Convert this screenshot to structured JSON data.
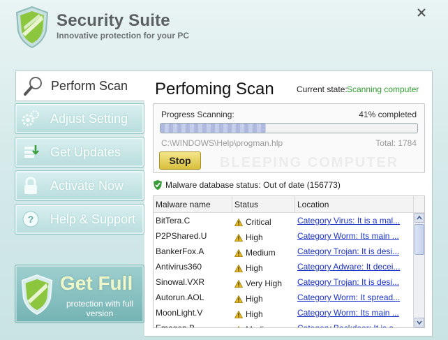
{
  "app": {
    "title": "Security Suite",
    "subtitle": "Innovative protection for your PC"
  },
  "nav": {
    "active": {
      "label": "Perform Scan",
      "icon": "magnifier-icon"
    },
    "items": [
      {
        "label": "Adjust Setting",
        "icon": "gears-icon"
      },
      {
        "label": "Get Updates",
        "icon": "updates-icon"
      },
      {
        "label": "Activate Now",
        "icon": "padlock-icon"
      },
      {
        "label": "Help & Support",
        "icon": "question-icon"
      }
    ]
  },
  "promo": {
    "title": "Get Full",
    "subtitle": "protection with full version"
  },
  "scan": {
    "title": "Perfoming Scan",
    "state_label": "Current state:",
    "state_value": "Scanning computer",
    "progress_label": "Progress Scanning:",
    "percent_text": "41% completed",
    "progress_fraction": 0.41,
    "current_file": "C:\\WINDOWS\\Help\\progman.hlp",
    "total_text": "Total: 1784",
    "stop_label": "Stop",
    "watermark": "BLEEPING COMPUTER"
  },
  "db_status": "Malware database status: Out of date (156773)",
  "table": {
    "columns": [
      "Malware name",
      "Status",
      "Location"
    ],
    "rows": [
      {
        "name": "BitTera.C",
        "status": "Critical",
        "location": "Category Virus: It is a mal..."
      },
      {
        "name": "P2PShared.U",
        "status": "High",
        "location": "Category Worm: Its main ..."
      },
      {
        "name": "BankerFox.A",
        "status": "Medium",
        "location": "Category Trojan: It is desi..."
      },
      {
        "name": "Antivirus360",
        "status": "High",
        "location": "Category Adware: It decei..."
      },
      {
        "name": "Sinowal.VXR",
        "status": "Very High",
        "location": "Category Trojan: It is desi..."
      },
      {
        "name": "Autorun.AOL",
        "status": "High",
        "location": "Category Worm: It spread..."
      },
      {
        "name": "MoonLight.V",
        "status": "High",
        "location": "Category Worm: Its main ..."
      },
      {
        "name": "Emogen.B",
        "status": "Medium",
        "location": "Category Backdoor: It is a ..."
      }
    ]
  },
  "colors": {
    "accent": "#2e9e2e",
    "link": "#1a31c8",
    "panel_teal": "#b9dddd",
    "stop_button": "#d8bf3c"
  }
}
